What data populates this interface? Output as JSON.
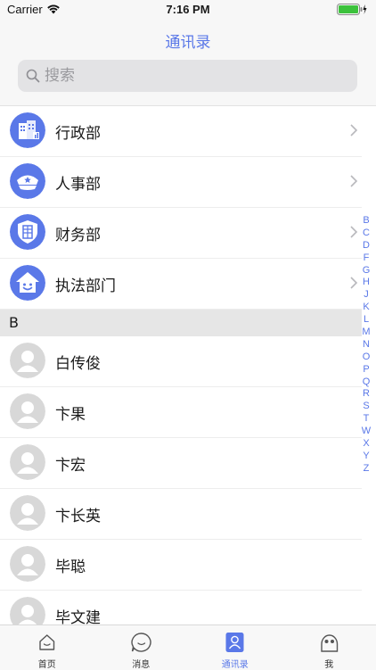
{
  "status_bar": {
    "carrier": "Carrier",
    "time": "7:16 PM"
  },
  "nav": {
    "title": "通讯录"
  },
  "search": {
    "placeholder": "搜索"
  },
  "departments": [
    {
      "label": "行政部",
      "icon": "building-icon"
    },
    {
      "label": "人事部",
      "icon": "police-cap-icon"
    },
    {
      "label": "财务部",
      "icon": "shield-building-icon"
    },
    {
      "label": "执法部门",
      "icon": "house-smile-icon"
    }
  ],
  "section": {
    "letter": "B"
  },
  "contacts": [
    "白传俊",
    "卞果",
    "卞宏",
    "卞长英",
    "毕聪",
    "毕文建"
  ],
  "index_letters": [
    "B",
    "C",
    "D",
    "F",
    "G",
    "H",
    "J",
    "K",
    "L",
    "M",
    "N",
    "O",
    "P",
    "Q",
    "R",
    "S",
    "T",
    "W",
    "X",
    "Y",
    "Z"
  ],
  "tabs": [
    {
      "label": "首页",
      "icon": "home-icon",
      "active": false
    },
    {
      "label": "消息",
      "icon": "message-icon",
      "active": false
    },
    {
      "label": "通讯录",
      "icon": "contacts-icon",
      "active": true
    },
    {
      "label": "我",
      "icon": "profile-icon",
      "active": false
    }
  ],
  "colors": {
    "accent": "#5a78e8",
    "avatar_gray": "#d8d8d8",
    "section_bg": "#e6e6e6"
  }
}
